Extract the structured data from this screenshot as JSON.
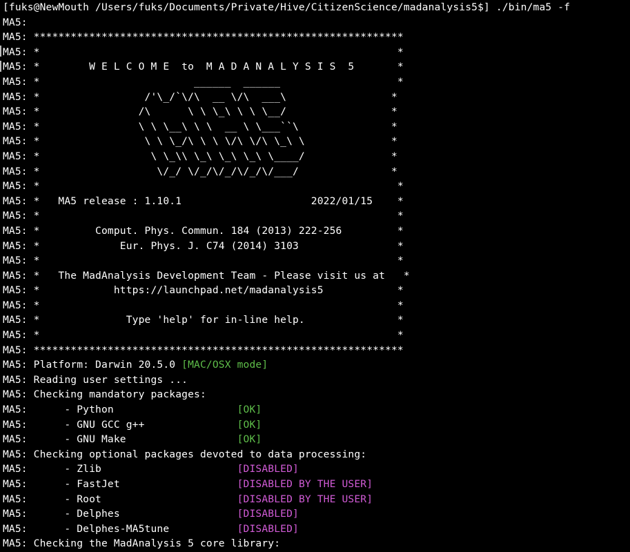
{
  "terminal": {
    "colors": {
      "background": "#000000",
      "default": "#ffffff",
      "green": "#5fbf4a",
      "magenta": "#d15bd6"
    },
    "lines": [
      [
        {
          "t": "[fuks@NewMouth /Users/fuks/Documents/Private/Hive/CitizenScience/madanalysis5$] ./bin/ma5 -f",
          "c": "default"
        }
      ],
      [
        {
          "t": "MA5:",
          "c": "default"
        }
      ],
      [
        {
          "t": "MA5: ************************************************************",
          "c": "default"
        }
      ],
      [
        {
          "t": "MA5: *                                                          *",
          "c": "default"
        }
      ],
      [
        {
          "t": "MA5: *        W E L C O M E  to  M A D A N A L Y S I S  5       *",
          "c": "default"
        }
      ],
      [
        {
          "t": "MA5: *                         ______  ______                   *",
          "c": "default"
        }
      ],
      [
        {
          "t": "MA5: *                 /'\\_/`\\/\\  __ \\/\\  ___\\                 *",
          "c": "default"
        }
      ],
      [
        {
          "t": "MA5: *                /\\      \\ \\ \\_\\ \\ \\ \\__/                 *",
          "c": "default"
        }
      ],
      [
        {
          "t": "MA5: *                \\ \\ \\__\\ \\ \\  __ \\ \\___``\\               *",
          "c": "default"
        }
      ],
      [
        {
          "t": "MA5: *                 \\ \\ \\_/\\ \\ \\ \\/\\ \\/\\ \\_\\ \\              *",
          "c": "default"
        }
      ],
      [
        {
          "t": "MA5: *                  \\ \\_\\\\ \\_\\ \\_\\ \\_\\ \\____/              *",
          "c": "default"
        }
      ],
      [
        {
          "t": "MA5: *                   \\/_/ \\/_/\\/_/\\/_/\\/___/               *",
          "c": "default"
        }
      ],
      [
        {
          "t": "MA5: *                                                          *",
          "c": "default"
        }
      ],
      [
        {
          "t": "MA5: *   MA5 release : 1.10.1                     2022/01/15    *",
          "c": "default"
        }
      ],
      [
        {
          "t": "MA5: *                                                          *",
          "c": "default"
        }
      ],
      [
        {
          "t": "MA5: *         Comput. Phys. Commun. 184 (2013) 222-256         *",
          "c": "default"
        }
      ],
      [
        {
          "t": "MA5: *             Eur. Phys. J. C74 (2014) 3103                *",
          "c": "default"
        }
      ],
      [
        {
          "t": "MA5: *                                                          *",
          "c": "default"
        }
      ],
      [
        {
          "t": "MA5: *   The MadAnalysis Development Team - Please visit us at   *",
          "c": "default"
        }
      ],
      [
        {
          "t": "MA5: *            https://launchpad.net/madanalysis5            *",
          "c": "default"
        }
      ],
      [
        {
          "t": "MA5: *                                                          *",
          "c": "default"
        }
      ],
      [
        {
          "t": "MA5: *              Type 'help' for in-line help.               *",
          "c": "default"
        }
      ],
      [
        {
          "t": "MA5: *                                                          *",
          "c": "default"
        }
      ],
      [
        {
          "t": "MA5: ************************************************************",
          "c": "default"
        }
      ],
      [
        {
          "t": "MA5: Platform: Darwin 20.5.0 ",
          "c": "default"
        },
        {
          "t": "[MAC/OSX mode]",
          "c": "green"
        }
      ],
      [
        {
          "t": "MA5: Reading user settings ...",
          "c": "default"
        }
      ],
      [
        {
          "t": "MA5: Checking mandatory packages:",
          "c": "default"
        }
      ],
      [
        {
          "t": "MA5:      - Python                    ",
          "c": "default"
        },
        {
          "t": "[OK]",
          "c": "green"
        }
      ],
      [
        {
          "t": "MA5:      - GNU GCC g++               ",
          "c": "default"
        },
        {
          "t": "[OK]",
          "c": "green"
        }
      ],
      [
        {
          "t": "MA5:      - GNU Make                  ",
          "c": "default"
        },
        {
          "t": "[OK]",
          "c": "green"
        }
      ],
      [
        {
          "t": "MA5: Checking optional packages devoted to data processing:",
          "c": "default"
        }
      ],
      [
        {
          "t": "MA5:      - Zlib                      ",
          "c": "default"
        },
        {
          "t": "[DISABLED]",
          "c": "magenta"
        }
      ],
      [
        {
          "t": "MA5:      - FastJet                   ",
          "c": "default"
        },
        {
          "t": "[DISABLED BY THE USER]",
          "c": "magenta"
        }
      ],
      [
        {
          "t": "MA5:      - Root                      ",
          "c": "default"
        },
        {
          "t": "[DISABLED BY THE USER]",
          "c": "magenta"
        }
      ],
      [
        {
          "t": "MA5:      - Delphes                   ",
          "c": "default"
        },
        {
          "t": "[DISABLED]",
          "c": "magenta"
        }
      ],
      [
        {
          "t": "MA5:      - Delphes-MA5tune           ",
          "c": "default"
        },
        {
          "t": "[DISABLED]",
          "c": "magenta"
        }
      ],
      [
        {
          "t": "MA5: Checking the MadAnalysis 5 core library:",
          "c": "default"
        }
      ]
    ]
  }
}
